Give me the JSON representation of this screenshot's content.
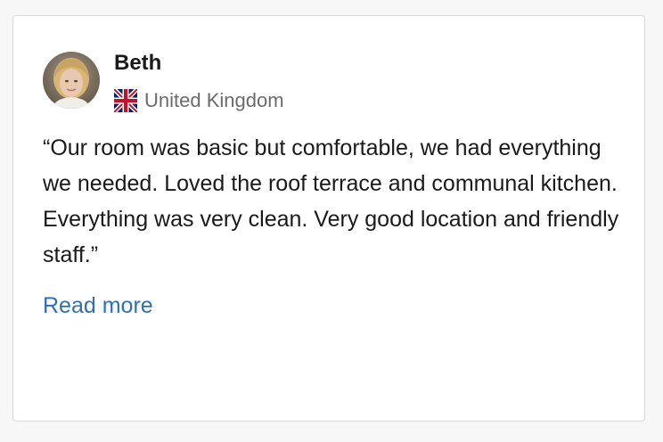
{
  "review": {
    "reviewer_name": "Beth",
    "country": "United Kingdom",
    "country_flag_icon": "united-kingdom-flag-icon",
    "quote": "“Our room was basic but comfortable, we had everything we needed. Loved the roof terrace and communal kitchen. Everything was very clean. Very good location and friendly staff.”",
    "read_more_label": "Read more"
  },
  "colors": {
    "link": "#2f6fb8",
    "name_text": "#1a1a1a",
    "country_text": "#6b6b6b",
    "card_border": "#d9d9d9",
    "page_background": "#f7f7f7"
  }
}
